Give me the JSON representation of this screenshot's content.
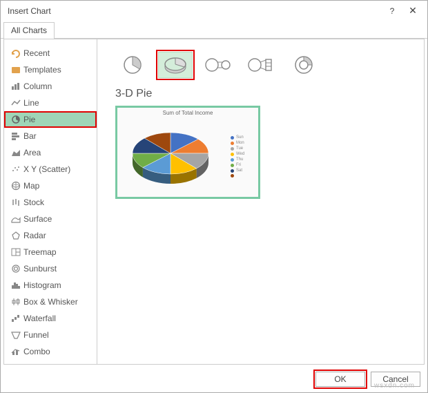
{
  "window": {
    "title": "Insert Chart",
    "help": "?",
    "close": "✕"
  },
  "tab": {
    "all_charts": "All Charts"
  },
  "sidebar": {
    "items": [
      {
        "label": "Recent"
      },
      {
        "label": "Templates"
      },
      {
        "label": "Column"
      },
      {
        "label": "Line"
      },
      {
        "label": "Pie"
      },
      {
        "label": "Bar"
      },
      {
        "label": "Area"
      },
      {
        "label": "X Y (Scatter)"
      },
      {
        "label": "Map"
      },
      {
        "label": "Stock"
      },
      {
        "label": "Surface"
      },
      {
        "label": "Radar"
      },
      {
        "label": "Treemap"
      },
      {
        "label": "Sunburst"
      },
      {
        "label": "Histogram"
      },
      {
        "label": "Box & Whisker"
      },
      {
        "label": "Waterfall"
      },
      {
        "label": "Funnel"
      },
      {
        "label": "Combo"
      }
    ]
  },
  "subtype_title": "3-D Pie",
  "preview": {
    "title": "Sum of Total Income",
    "legend": [
      {
        "label": "Sun",
        "color": "#4472c4"
      },
      {
        "label": "Mon",
        "color": "#ed7d31"
      },
      {
        "label": "Tue",
        "color": "#a5a5a5"
      },
      {
        "label": "Wed",
        "color": "#ffc000"
      },
      {
        "label": "Thu",
        "color": "#5b9bd5"
      },
      {
        "label": "Fri",
        "color": "#70ad47"
      },
      {
        "label": "Sat",
        "color": "#264478"
      },
      {
        "label": "",
        "color": "#9e480e"
      }
    ]
  },
  "chart_data": {
    "type": "pie",
    "title": "Sum of Total Income",
    "categories": [
      "Sun",
      "Mon",
      "Tue",
      "Wed",
      "Thu",
      "Fri",
      "Sat",
      ""
    ],
    "values": [
      13,
      12,
      13,
      12,
      13,
      12,
      13,
      12
    ],
    "colors": [
      "#4472c4",
      "#ed7d31",
      "#a5a5a5",
      "#ffc000",
      "#5b9bd5",
      "#70ad47",
      "#264478",
      "#9e480e"
    ]
  },
  "buttons": {
    "ok": "OK",
    "cancel": "Cancel"
  },
  "watermark": "wsxdn.com"
}
